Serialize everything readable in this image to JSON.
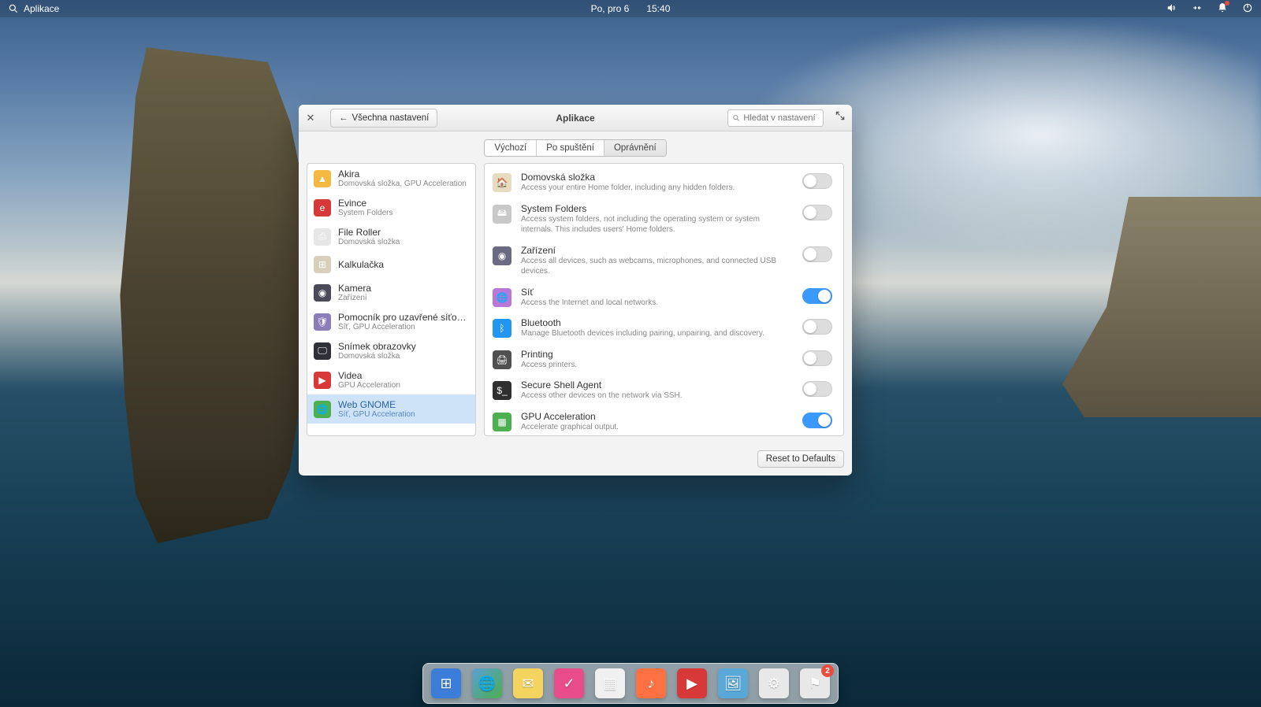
{
  "top_panel": {
    "apps_label": "Aplikace",
    "date": "Po, pro  6",
    "time": "15:40"
  },
  "window": {
    "title": "Aplikace",
    "back_label": "Všechna nastavení",
    "search_placeholder": "Hledat v nastavení",
    "tabs": [
      "Výchozí",
      "Po spuštění",
      "Oprávnění"
    ],
    "active_tab": 2,
    "reset_label": "Reset to Defaults"
  },
  "apps": [
    {
      "name": "Akira",
      "sub": "Domovská složka, GPU Acceleration",
      "icon_bg": "#f4b942",
      "glyph": "▲"
    },
    {
      "name": "Evince",
      "sub": "System Folders",
      "icon_bg": "#d73838",
      "glyph": "e"
    },
    {
      "name": "File Roller",
      "sub": "Domovská složka",
      "icon_bg": "#e6e6e6",
      "glyph": "⎙"
    },
    {
      "name": "Kalkulačka",
      "sub": "",
      "icon_bg": "#d8d0bc",
      "glyph": "⊞"
    },
    {
      "name": "Kamera",
      "sub": "Zařízení",
      "icon_bg": "#4a4a5a",
      "glyph": "◉"
    },
    {
      "name": "Pomocník pro uzavřené síťové ...",
      "sub": "Síť, GPU Acceleration",
      "icon_bg": "#8a7db8",
      "glyph": "🛡"
    },
    {
      "name": "Snímek obrazovky",
      "sub": "Domovská složka",
      "icon_bg": "#303038",
      "glyph": "🖵"
    },
    {
      "name": "Videa",
      "sub": "GPU Acceleration",
      "icon_bg": "#d73838",
      "glyph": "▶"
    },
    {
      "name": "Web GNOME",
      "sub": "Síť, GPU Acceleration",
      "icon_bg": "#4caf50",
      "glyph": "🌐"
    }
  ],
  "selected_app": 8,
  "permissions": [
    {
      "title": "Domovská složka",
      "desc": "Access your entire Home folder, including any hidden folders.",
      "on": false,
      "icon_bg": "#e8dcc0",
      "glyph": "🏠"
    },
    {
      "title": "System Folders",
      "desc": "Access system folders, not including the operating system or system internals. This includes users' Home folders.",
      "on": false,
      "icon_bg": "#c8c8c8",
      "glyph": "🖴"
    },
    {
      "title": "Zařízení",
      "desc": "Access all devices, such as webcams, microphones, and connected USB devices.",
      "on": false,
      "icon_bg": "#6a6a80",
      "glyph": "◉"
    },
    {
      "title": "Síť",
      "desc": "Access the Internet and local networks.",
      "on": true,
      "icon_bg": "#b878d8",
      "glyph": "🌐"
    },
    {
      "title": "Bluetooth",
      "desc": "Manage Bluetooth devices including pairing, unpairing, and discovery.",
      "on": false,
      "icon_bg": "#2196f3",
      "glyph": "ᛒ"
    },
    {
      "title": "Printing",
      "desc": "Access printers.",
      "on": false,
      "icon_bg": "#505050",
      "glyph": "🖨"
    },
    {
      "title": "Secure Shell Agent",
      "desc": "Access other devices on the network via SSH.",
      "on": false,
      "icon_bg": "#303030",
      "glyph": "$_"
    },
    {
      "title": "GPU Acceleration",
      "desc": "Accelerate graphical output.",
      "on": true,
      "icon_bg": "#4caf50",
      "glyph": "▦"
    }
  ],
  "dock": [
    {
      "name": "multitasking",
      "bg": "#3b7dd8",
      "glyph": "⊞"
    },
    {
      "name": "web",
      "bg": "linear-gradient(135deg,#5a9fd4,#4caf50)",
      "glyph": "🌐"
    },
    {
      "name": "mail",
      "bg": "#f4d35e",
      "glyph": "✉"
    },
    {
      "name": "tasks",
      "bg": "#e84c8a",
      "glyph": "✓"
    },
    {
      "name": "calendar",
      "bg": "#f0f0f0",
      "glyph": "▦"
    },
    {
      "name": "music",
      "bg": "#ff7043",
      "glyph": "♪"
    },
    {
      "name": "videos",
      "bg": "#d73838",
      "glyph": "▶"
    },
    {
      "name": "photos",
      "bg": "#5aa8d8",
      "glyph": "🖼"
    },
    {
      "name": "settings",
      "bg": "#e8e8e8",
      "glyph": "⚙"
    },
    {
      "name": "appcenter",
      "bg": "#e8e8e8",
      "glyph": "⚑",
      "badge": "2"
    }
  ]
}
